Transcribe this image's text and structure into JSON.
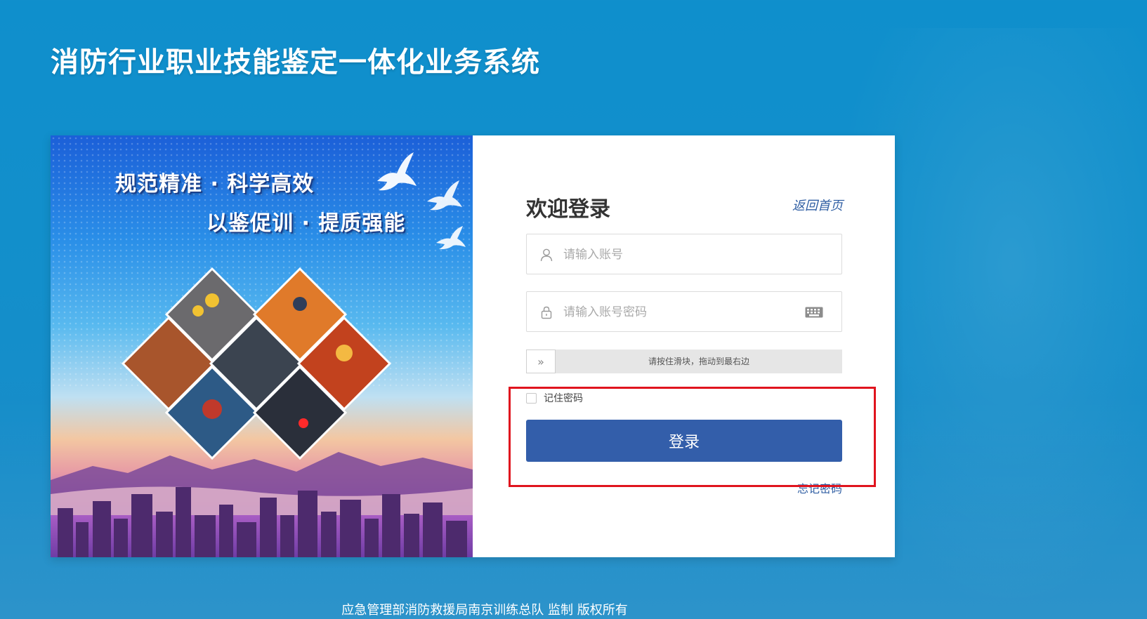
{
  "header": {
    "title": "消防行业职业技能鉴定一体化业务系统"
  },
  "banner": {
    "slogan_line1": "规范精准 · 科学高效",
    "slogan_line2": "以鉴促训 · 提质强能"
  },
  "login": {
    "welcome": "欢迎登录",
    "back_home": "返回首页",
    "account_placeholder": "请输入账号",
    "password_placeholder": "请输入账号密码",
    "slider_hint": "请按住滑块，拖动到最右边",
    "slider_handle": "»",
    "remember": "记住密码",
    "submit": "登录",
    "forgot": "忘记密码"
  },
  "footer": {
    "copyright": "应急管理部消防救援局南京训练总队 监制 版权所有"
  },
  "colors": {
    "background": "#138fcb",
    "primary_button": "#335eaa",
    "link": "#2f5ea3",
    "highlight": "#e0141e"
  },
  "icons": {
    "account": "user-icon",
    "password": "lock-icon",
    "keyboard": "keyboard-icon",
    "slider": "double-chevron-right-icon"
  }
}
